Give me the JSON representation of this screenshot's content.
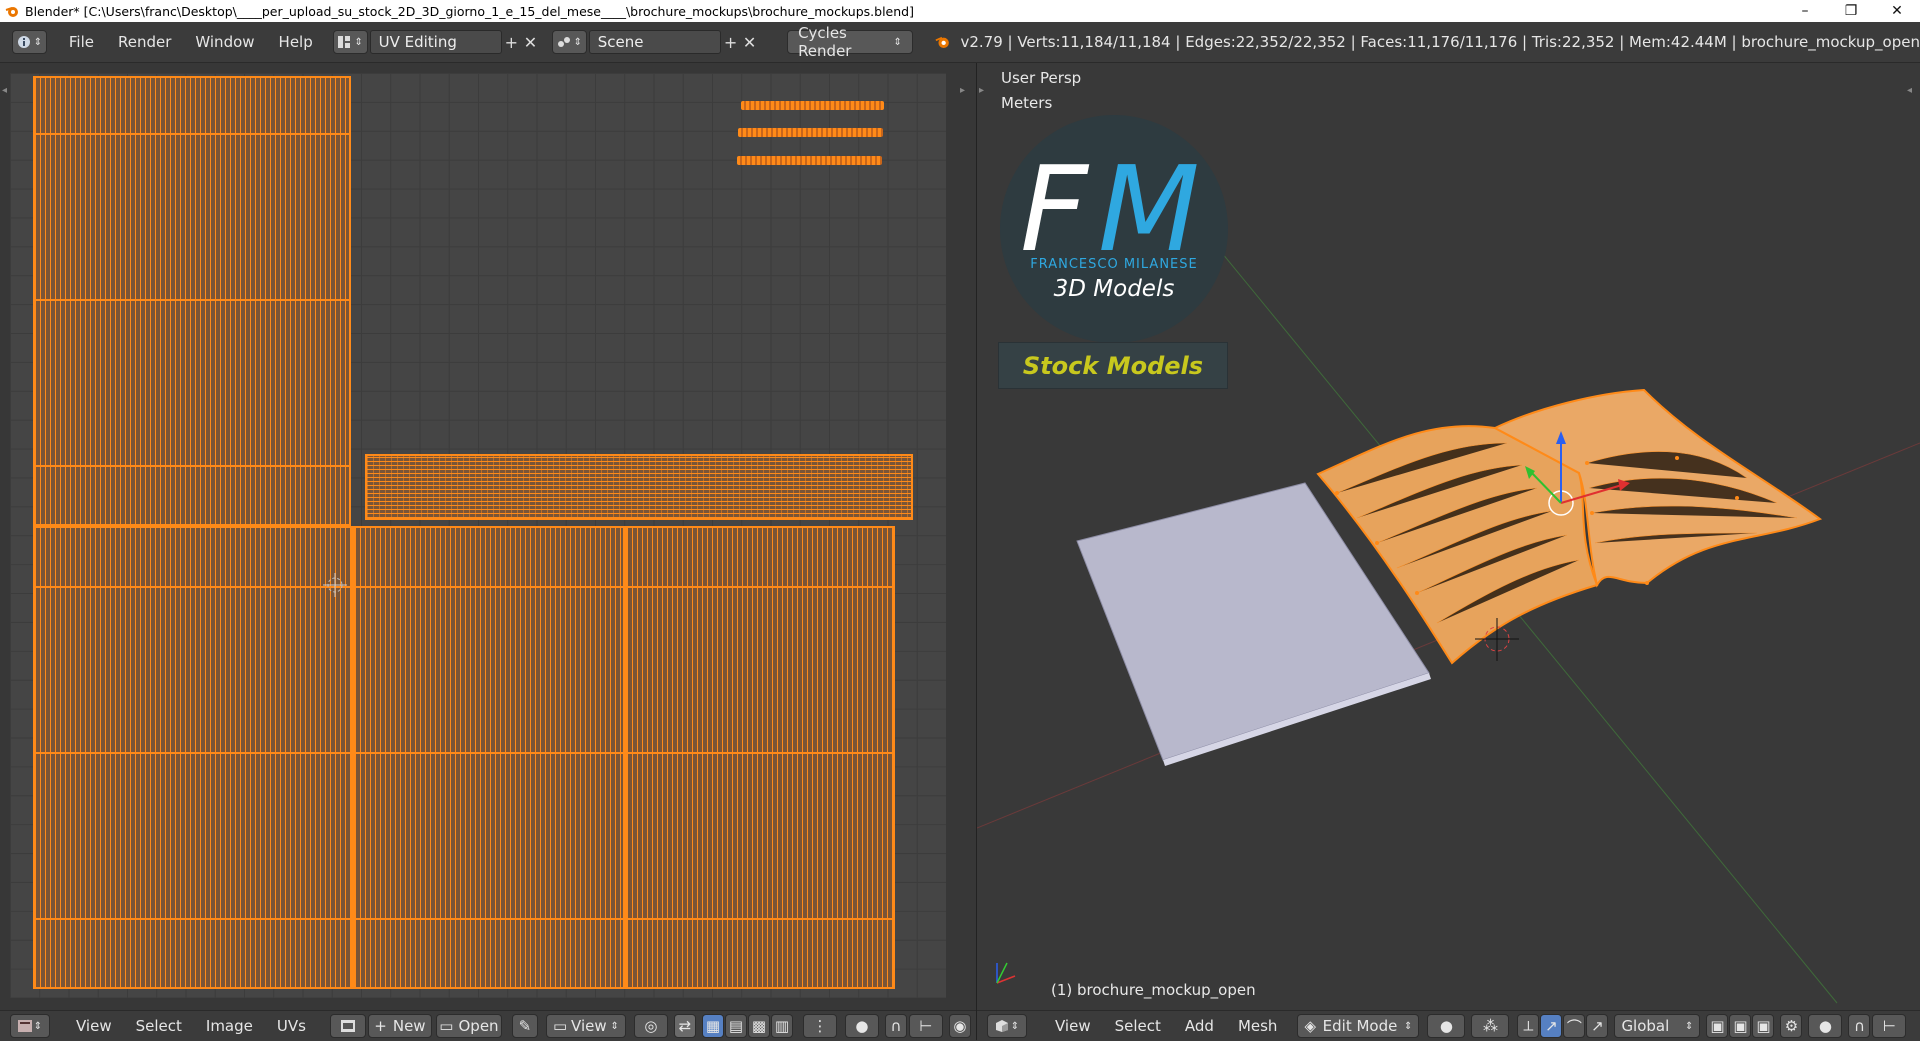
{
  "window": {
    "title": "Blender* [C:\\Users\\franc\\Desktop\\____per_upload_su_stock_2D_3D_giorno_1_e_15_del_mese____\\brochure_mockups\\brochure_mockups.blend]",
    "minimize": "–",
    "restore": "❐",
    "close": "✕"
  },
  "header": {
    "menus": [
      "File",
      "Render",
      "Window",
      "Help"
    ],
    "screen_layout": "UV Editing",
    "scene": "Scene",
    "render_engine": "Cycles Render",
    "stats": "v2.79 | Verts:11,184/11,184 | Edges:22,352/22,352 | Faces:11,176/11,176 | Tris:22,352 | Mem:42.44M | brochure_mockup_open"
  },
  "viewport": {
    "view_name": "User Persp",
    "units": "Meters",
    "object_label": "(1) brochure_mockup_open"
  },
  "logo": {
    "letters_f": "F",
    "letters_m": "M",
    "author": "FRANCESCO MILANESE",
    "subtitle": "3D Models",
    "banner": "Stock Models"
  },
  "uv_footer": {
    "menus": [
      "View",
      "Select",
      "Image",
      "UVs"
    ],
    "new_label": "New",
    "open_label": "Open",
    "view_label": "View"
  },
  "view3d_footer": {
    "menus": [
      "View",
      "Select",
      "Add",
      "Mesh"
    ],
    "mode": "Edit Mode",
    "orientation": "Global"
  },
  "colors": {
    "uv_orange": "#ff8a18",
    "logo_blue": "#2fa8e0",
    "logo_yellow": "#c8c81e"
  }
}
